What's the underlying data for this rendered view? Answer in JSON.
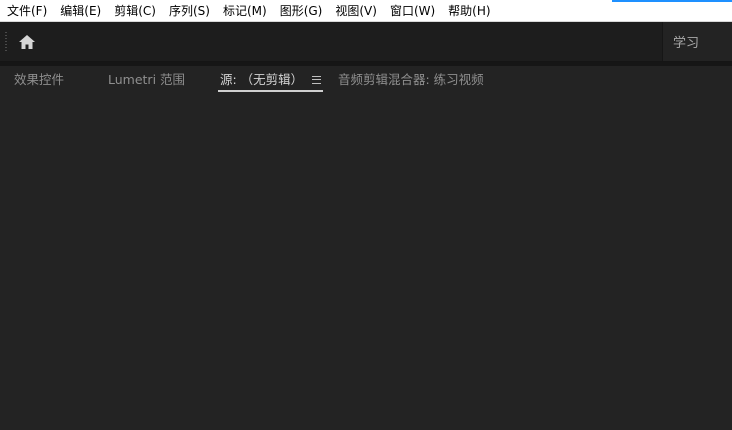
{
  "menu": {
    "items": [
      {
        "label": "文件(F)"
      },
      {
        "label": "编辑(E)"
      },
      {
        "label": "剪辑(C)"
      },
      {
        "label": "序列(S)"
      },
      {
        "label": "标记(M)"
      },
      {
        "label": "图形(G)"
      },
      {
        "label": "视图(V)"
      },
      {
        "label": "窗口(W)"
      },
      {
        "label": "帮助(H)"
      }
    ]
  },
  "header": {
    "home_icon": "home-icon",
    "workspace_tab": "学习"
  },
  "panel": {
    "tabs": [
      {
        "label": "效果控件"
      },
      {
        "label": "Lumetri 范围"
      },
      {
        "label": "源: （无剪辑）",
        "active": true
      },
      {
        "label": "音频剪辑混合器: 练习视频"
      }
    ],
    "menu_icon": "hamburger-menu-icon"
  },
  "colors": {
    "background": "#232323",
    "header": "#1d1d1d",
    "menubar": "#ffffff",
    "accent": "#1e90ff"
  }
}
